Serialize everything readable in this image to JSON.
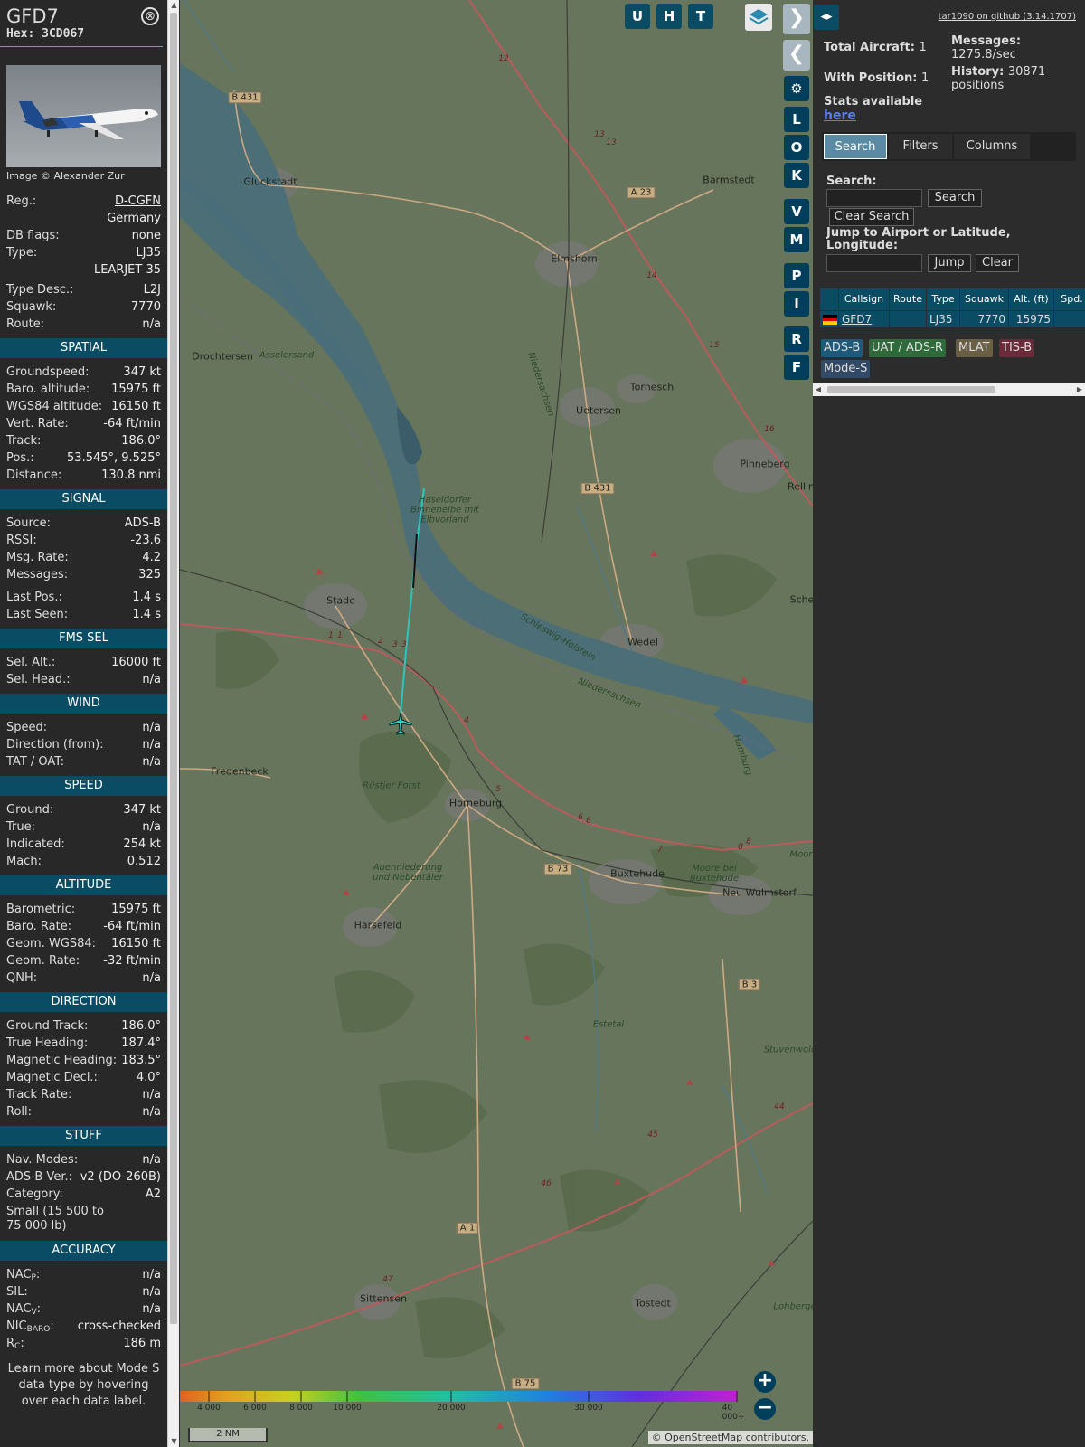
{
  "info": {
    "callsign": "GFD7",
    "hex_label": "Hex:",
    "hex": "3CD067",
    "close_glyph": "⊗",
    "photo_credit": "Image © Alexander Zur",
    "reg_label": "Reg.:",
    "reg": "D-CGFN",
    "country": "Germany",
    "dbflags_label": "DB flags:",
    "dbflags": "none",
    "type_label": "Type:",
    "type": "LJ35",
    "type_name": "LEARJET 35",
    "typedesc_label": "Type Desc.:",
    "typedesc": "L2J",
    "squawk_label": "Squawk:",
    "squawk": "7770",
    "route_label": "Route:",
    "route": "n/a"
  },
  "spatial": {
    "title": "SPATIAL",
    "rows": [
      {
        "k": "Groundspeed:",
        "v": "347 kt"
      },
      {
        "k": "Baro. altitude:",
        "v": "15975 ft"
      },
      {
        "k": "WGS84 altitude:",
        "v": "16150 ft"
      },
      {
        "k": "Vert. Rate:",
        "v": "-64 ft/min"
      },
      {
        "k": "Track:",
        "v": "186.0°"
      },
      {
        "k": "Pos.:",
        "v": "53.545°, 9.525°"
      },
      {
        "k": "Distance:",
        "v": "130.8 nmi"
      }
    ]
  },
  "signal": {
    "title": "SIGNAL",
    "rows": [
      {
        "k": "Source:",
        "v": "ADS-B"
      },
      {
        "k": "RSSI:",
        "v": "-23.6"
      },
      {
        "k": "Msg. Rate:",
        "v": "4.2"
      },
      {
        "k": "Messages:",
        "v": "325"
      }
    ],
    "rows2": [
      {
        "k": "Last Pos.:",
        "v": "1.4 s"
      },
      {
        "k": "Last Seen:",
        "v": "1.4 s"
      }
    ]
  },
  "fms": {
    "title": "FMS SEL",
    "rows": [
      {
        "k": "Sel. Alt.:",
        "v": "16000 ft"
      },
      {
        "k": "Sel. Head.:",
        "v": "n/a"
      }
    ]
  },
  "wind": {
    "title": "WIND",
    "rows": [
      {
        "k": "Speed:",
        "v": "n/a"
      },
      {
        "k": "Direction (from):",
        "v": "n/a"
      },
      {
        "k": "TAT / OAT:",
        "v": "n/a"
      }
    ]
  },
  "speed": {
    "title": "SPEED",
    "rows": [
      {
        "k": "Ground:",
        "v": "347 kt"
      },
      {
        "k": "True:",
        "v": "n/a"
      },
      {
        "k": "Indicated:",
        "v": "254 kt"
      },
      {
        "k": "Mach:",
        "v": "0.512"
      }
    ]
  },
  "altitude": {
    "title": "ALTITUDE",
    "rows": [
      {
        "k": "Barometric:",
        "v": "15975 ft"
      },
      {
        "k": "Baro. Rate:",
        "v": "-64 ft/min"
      },
      {
        "k": "Geom. WGS84:",
        "v": "16150 ft"
      },
      {
        "k": "Geom. Rate:",
        "v": "-32 ft/min"
      },
      {
        "k": "QNH:",
        "v": "n/a"
      }
    ]
  },
  "direction": {
    "title": "DIRECTION",
    "rows": [
      {
        "k": "Ground Track:",
        "v": "186.0°"
      },
      {
        "k": "True Heading:",
        "v": "187.4°"
      },
      {
        "k": "Magnetic Heading:",
        "v": "183.5°"
      },
      {
        "k": "Magnetic Decl.:",
        "v": "4.0°"
      },
      {
        "k": "Track Rate:",
        "v": "n/a"
      },
      {
        "k": "Roll:",
        "v": "n/a"
      }
    ]
  },
  "stuff": {
    "title": "STUFF",
    "navmodes_label": "Nav. Modes:",
    "navmodes": "n/a",
    "adsbver_label": "ADS-B Ver.:",
    "adsbver": "v2 (DO-260B)",
    "category_label": "Category:",
    "category": "A2",
    "category_desc": "Small (15 500 to 75 000 lb)"
  },
  "accuracy": {
    "title": "ACCURACY",
    "nacp_label": "NAC",
    "nacp_sub": "P",
    "nacp": "n/a",
    "sil_label": "SIL:",
    "sil": "n/a",
    "nacv_label": "NAC",
    "nacv_sub": "V",
    "nacv": "n/a",
    "nicbaro_label": "NIC",
    "nicbaro_sub": "BARO",
    "nicbaro": "cross-checked",
    "rc_label": "R",
    "rc_sub": "C",
    "rc": "186 m"
  },
  "footer": "Learn more about Mode S data type by hovering over each data label.",
  "map": {
    "top_buttons": [
      "U",
      "H",
      "T"
    ],
    "side_buttons": [
      "L",
      "O",
      "K",
      "V",
      "M",
      "P",
      "I",
      "R",
      "F"
    ],
    "gear_icon": "⚙",
    "zoom_in": "+",
    "zoom_out": "−",
    "scale_labels": [
      "4 000",
      "6 000",
      "8 000",
      "10 000",
      "20 000",
      "30 000",
      "40 000+"
    ],
    "nm_scale": "2 NM",
    "attribution_prefix": "© ",
    "attribution_link": "OpenStreetMap",
    "attribution_suffix": " contributors.",
    "places": [
      "Gluckstadt",
      "Barmstedt",
      "Elmshorn",
      "Drochtersen",
      "Asselersand",
      "Tornesch",
      "Uetersen",
      "Pinneberg",
      "Rellin",
      "Haseldorfer Binnenelbe mit Elbvorland",
      "Stade",
      "Sche",
      "Wedel",
      "Fredenbeck",
      "Rüstjer Forst",
      "Horneburg",
      "Auenniederung und Nebentäler",
      "Buxtehude",
      "Moore bei Buxtehude",
      "Neu Wulmstorf",
      "Harsefeld",
      "Estetal",
      "Stuvenwold",
      "Sittensen",
      "Tostedt",
      "Lohberge",
      "Moor",
      "Hamburg",
      "Niedersachsen",
      "Schleswig-Holstein",
      "Niedersachsen"
    ],
    "roads": [
      "B 431",
      "A 23",
      "B 431",
      "B 73",
      "B 3",
      "A 1",
      "B 75"
    ],
    "km_marks": [
      "12",
      "13",
      "13",
      "14",
      "15",
      "16",
      "1",
      "1",
      "2",
      "3",
      "3",
      "4",
      "5",
      "6",
      "6",
      "7",
      "8",
      "8",
      "44",
      "45",
      "46",
      "47"
    ]
  },
  "side": {
    "github": "tar1090 on github (3.14.1707)",
    "collapse_glyph": "◂▸",
    "total_label": "Total Aircraft:",
    "total": "1",
    "withpos_label": "With Position:",
    "withpos": "1",
    "messages_label": "Messages:",
    "messages": "1275.8/sec",
    "history_label": "History:",
    "history": "30871 positions",
    "stats_label": "Stats available",
    "stats_link": "here",
    "tabs": [
      "Search",
      "Filters",
      "Columns"
    ],
    "search_label": "Search:",
    "search_button": "Search",
    "clear_search": "Clear Search",
    "jump_label": "Jump to Airport or Latitude, Longitude:",
    "jump_button": "Jump",
    "clear_button": "Clear",
    "table_headers": [
      "Callsign",
      "Route",
      "Type",
      "Squawk",
      "Alt. (ft)",
      "Spd."
    ],
    "table_row": {
      "callsign": "GFD7",
      "route": "",
      "type": "LJ35",
      "squawk": "7770",
      "alt": "15975",
      "flag": "DE"
    },
    "legend": [
      "ADS-B",
      "UAT / ADS-R",
      "MLAT",
      "TIS-B",
      "Mode-S"
    ]
  },
  "colors": {
    "section_bg": "#0a4c63",
    "track": "#2ed0c8",
    "adsb": "#1d5a7a",
    "uat": "#2f6b3a",
    "mlat": "#6a5f45",
    "tisb": "#6a2a3a",
    "modes": "#334a66"
  }
}
